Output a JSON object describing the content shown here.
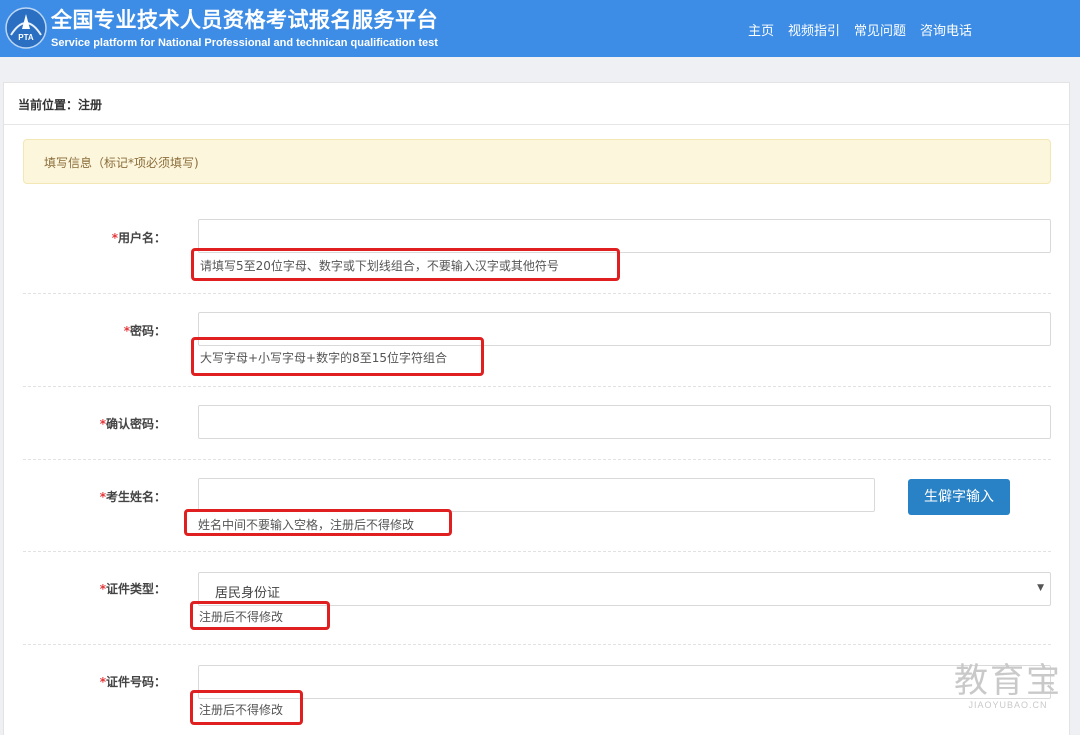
{
  "header": {
    "title": "全国专业技术人员资格考试报名服务平台",
    "subtitle": "Service platform for National Professional and technican qualification test",
    "logo_text": "PTA",
    "nav": [
      "主页",
      "视频指引",
      "常见问题",
      "咨询电话"
    ]
  },
  "breadcrumb": "当前位置：注册",
  "alert": "填写信息（标记*项必须填写)",
  "form": {
    "required_mark": "*",
    "username": {
      "label": "用户名：",
      "value": "",
      "hint": "请填写5至20位字母、数字或下划线组合，不要输入汉字或其他符号"
    },
    "password": {
      "label": "密码：",
      "value": "",
      "hint": "大写字母+小写字母+数字的8至15位字符组合"
    },
    "confirm_password": {
      "label": "确认密码：",
      "value": ""
    },
    "name": {
      "label": "考生姓名：",
      "value": "",
      "hint": "姓名中间不要输入空格，注册后不得修改",
      "button": "生僻字输入"
    },
    "id_type": {
      "label": "证件类型：",
      "selected": "居民身份证",
      "hint": "注册后不得修改"
    },
    "id_number": {
      "label": "证件号码：",
      "value": "",
      "hint": "注册后不得修改"
    }
  },
  "watermark": {
    "main": "教育宝",
    "sub": "JIAOYUBAO.CN"
  },
  "colors": {
    "header": "#3d8de6",
    "alert_bg": "#fcf6dc",
    "alert_text": "#8a6d3b",
    "highlight": "#e02020",
    "button": "#2a82c6"
  }
}
